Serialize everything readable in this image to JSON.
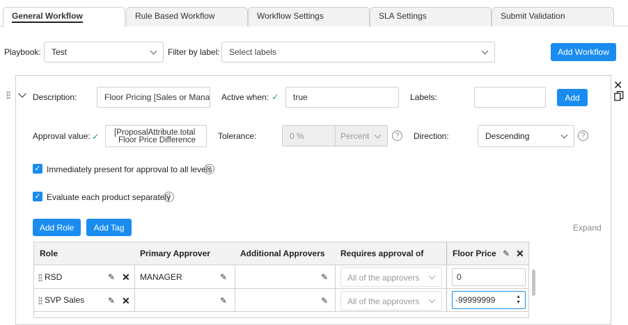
{
  "tabs": [
    "General Workflow",
    "Rule Based Workflow",
    "Workflow Settings",
    "SLA Settings",
    "Submit Validation"
  ],
  "filter": {
    "playbook_label": "Playbook:",
    "playbook_value": "Test",
    "filter_label": "Filter by label:",
    "filter_placeholder": "Select labels",
    "add_workflow": "Add Workflow"
  },
  "rule": {
    "description_label": "Description:",
    "description_value": "Floor Pricing [Sales or Mana",
    "active_when_label": "Active when:",
    "active_when_value": "true",
    "labels_label": "Labels:",
    "add_label": "Add",
    "approval_label": "Approval value:",
    "approval_value_line1": "[ProposalAttribute.total",
    "approval_value_line2": "Floor Price Difference",
    "tolerance_label": "Tolerance:",
    "tolerance_value": "0 %",
    "tolerance_unit": "Percent",
    "direction_label": "Direction:",
    "direction_value": "Descending",
    "check_immediately": "Immediately present for approval to all levels",
    "check_each_product": "Evaluate each product separately",
    "add_role": "Add Role",
    "add_tag": "Add Tag",
    "expand": "Expand"
  },
  "table": {
    "headers": [
      "Role",
      "Primary Approver",
      "Additional Approvers",
      "Requires approval of",
      "Floor Price"
    ],
    "rows": [
      {
        "role": "RSD",
        "primary": "MANAGER",
        "additional": "",
        "requires": "All of the approvers",
        "floor": "0"
      },
      {
        "role": "SVP Sales",
        "primary": "",
        "additional": "",
        "requires": "All of the approvers",
        "floor": "-99999999"
      }
    ]
  },
  "colors": {
    "accent": "#1a8cf0",
    "check": "#3aa757"
  }
}
